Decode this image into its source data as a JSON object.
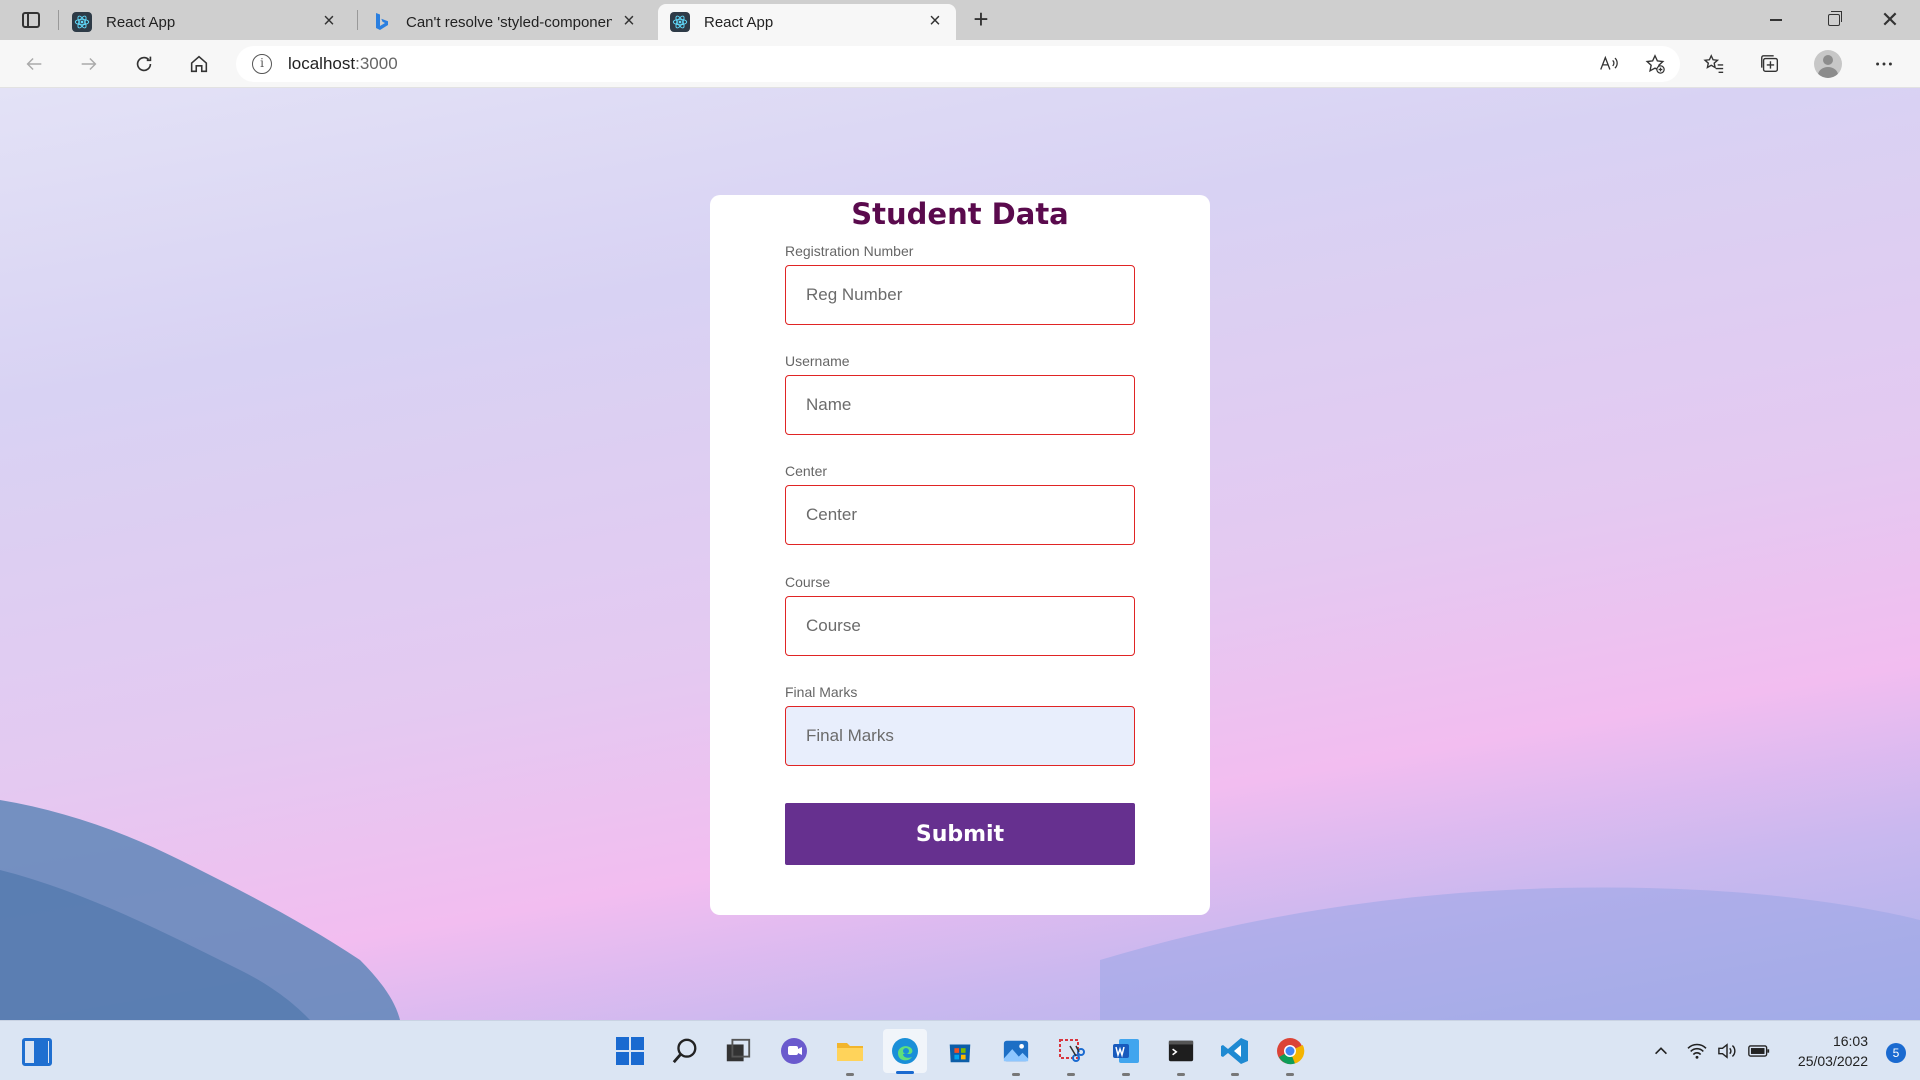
{
  "browser": {
    "tabs": [
      {
        "title": "React App",
        "favicon": "react-icon",
        "active": false
      },
      {
        "title": "Can't resolve 'styled-components'",
        "favicon": "bing-icon",
        "active": false
      },
      {
        "title": "React App",
        "favicon": "react-icon",
        "active": true
      }
    ],
    "new_tab": "+",
    "address": {
      "host": "localhost",
      "port": ":3000"
    }
  },
  "form": {
    "title": "Student Data",
    "fields": [
      {
        "label": "Registration Number",
        "placeholder": "Reg Number"
      },
      {
        "label": "Username",
        "placeholder": "Name"
      },
      {
        "label": "Center",
        "placeholder": "Center"
      },
      {
        "label": "Course",
        "placeholder": "Course"
      },
      {
        "label": "Final Marks",
        "placeholder": "Final Marks",
        "autofill": true
      }
    ],
    "submit_label": "Submit"
  },
  "taskbar": {
    "time": "16:03",
    "date": "25/03/2022",
    "notifications": "5"
  },
  "colors": {
    "title": "#5a0a4d",
    "input_border": "#e02424",
    "submit_bg": "#66308f",
    "autofill_bg": "#e8eefc"
  }
}
